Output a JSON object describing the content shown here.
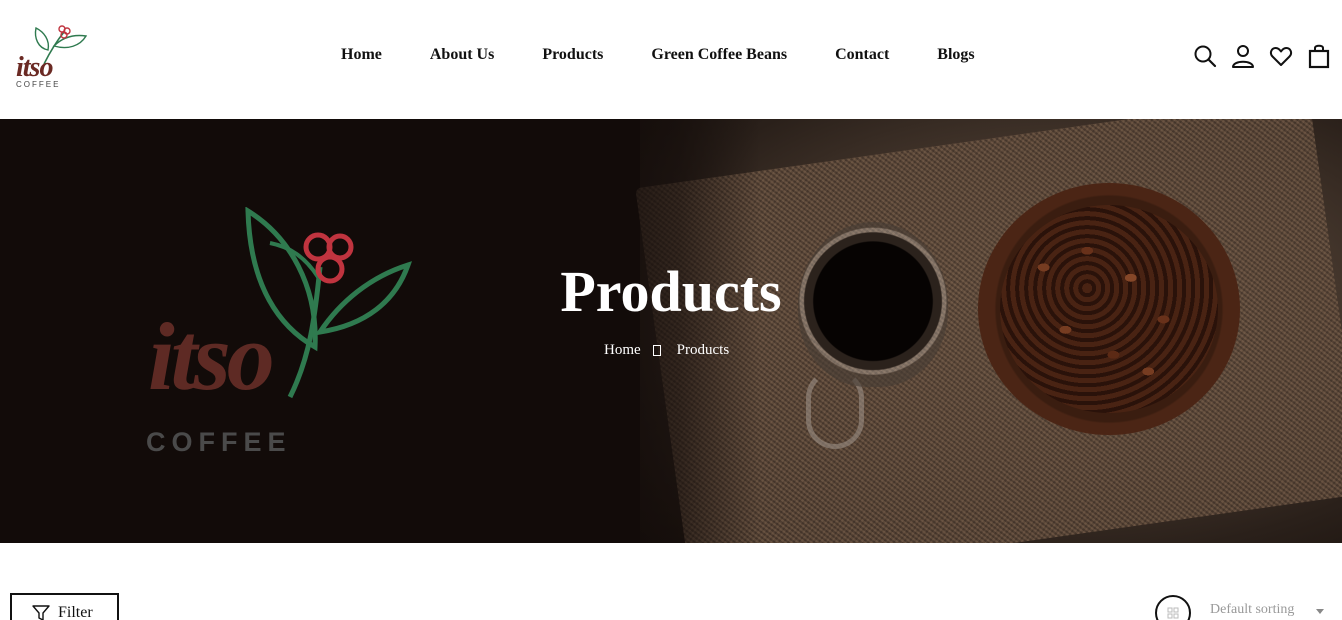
{
  "brand": {
    "name": "itso",
    "tagline": "COFFEE"
  },
  "nav": {
    "items": [
      {
        "label": "Home"
      },
      {
        "label": "About Us"
      },
      {
        "label": "Products"
      },
      {
        "label": "Green Coffee Beans"
      },
      {
        "label": "Contact"
      },
      {
        "label": "Blogs"
      }
    ]
  },
  "header_icons": [
    "search-icon",
    "account-icon",
    "wishlist-icon",
    "cart-icon"
  ],
  "hero": {
    "title": "Products",
    "breadcrumb": {
      "home": "Home",
      "current": "Products"
    },
    "logo_word": "itso",
    "logo_sub": "COFFEE"
  },
  "toolbar": {
    "filter_label": "Filter",
    "sort_selected": "Default sorting"
  },
  "colors": {
    "brand_red": "#6b2a24",
    "leaf_green": "#2f7a4f",
    "berry_red": "#c0343f",
    "hero_bg": "#120b09"
  }
}
